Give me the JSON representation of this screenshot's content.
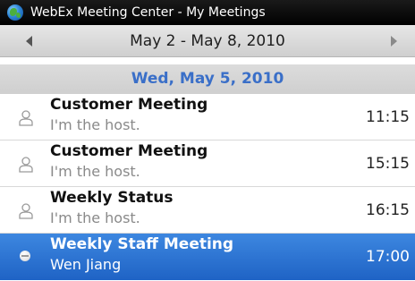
{
  "titlebar": {
    "icon": "webex-globe-icon",
    "text": "WebEx Meeting Center - My Meetings"
  },
  "navbar": {
    "range": "May 2 - May 8, 2010",
    "prev_icon": "left-arrow-icon",
    "next_icon": "right-arrow-icon"
  },
  "day_header": "Wed, May 5, 2010",
  "colors": {
    "day_header_text": "#3a6fc8",
    "selection": "#2a73d2"
  },
  "meetings": [
    {
      "title": "Customer Meeting",
      "subtitle": "I'm the host.",
      "time": "11:15",
      "icon": "person-icon",
      "selected": false
    },
    {
      "title": "Customer Meeting",
      "subtitle": "I'm the host.",
      "time": "15:15",
      "icon": "person-icon",
      "selected": false
    },
    {
      "title": "Weekly Status",
      "subtitle": "I'm the host.",
      "time": "16:15",
      "icon": "person-icon",
      "selected": false
    },
    {
      "title": "Weekly Staff Meeting",
      "subtitle": "Wen Jiang",
      "time": "17:00",
      "icon": "minus-circle-icon",
      "selected": true
    }
  ]
}
